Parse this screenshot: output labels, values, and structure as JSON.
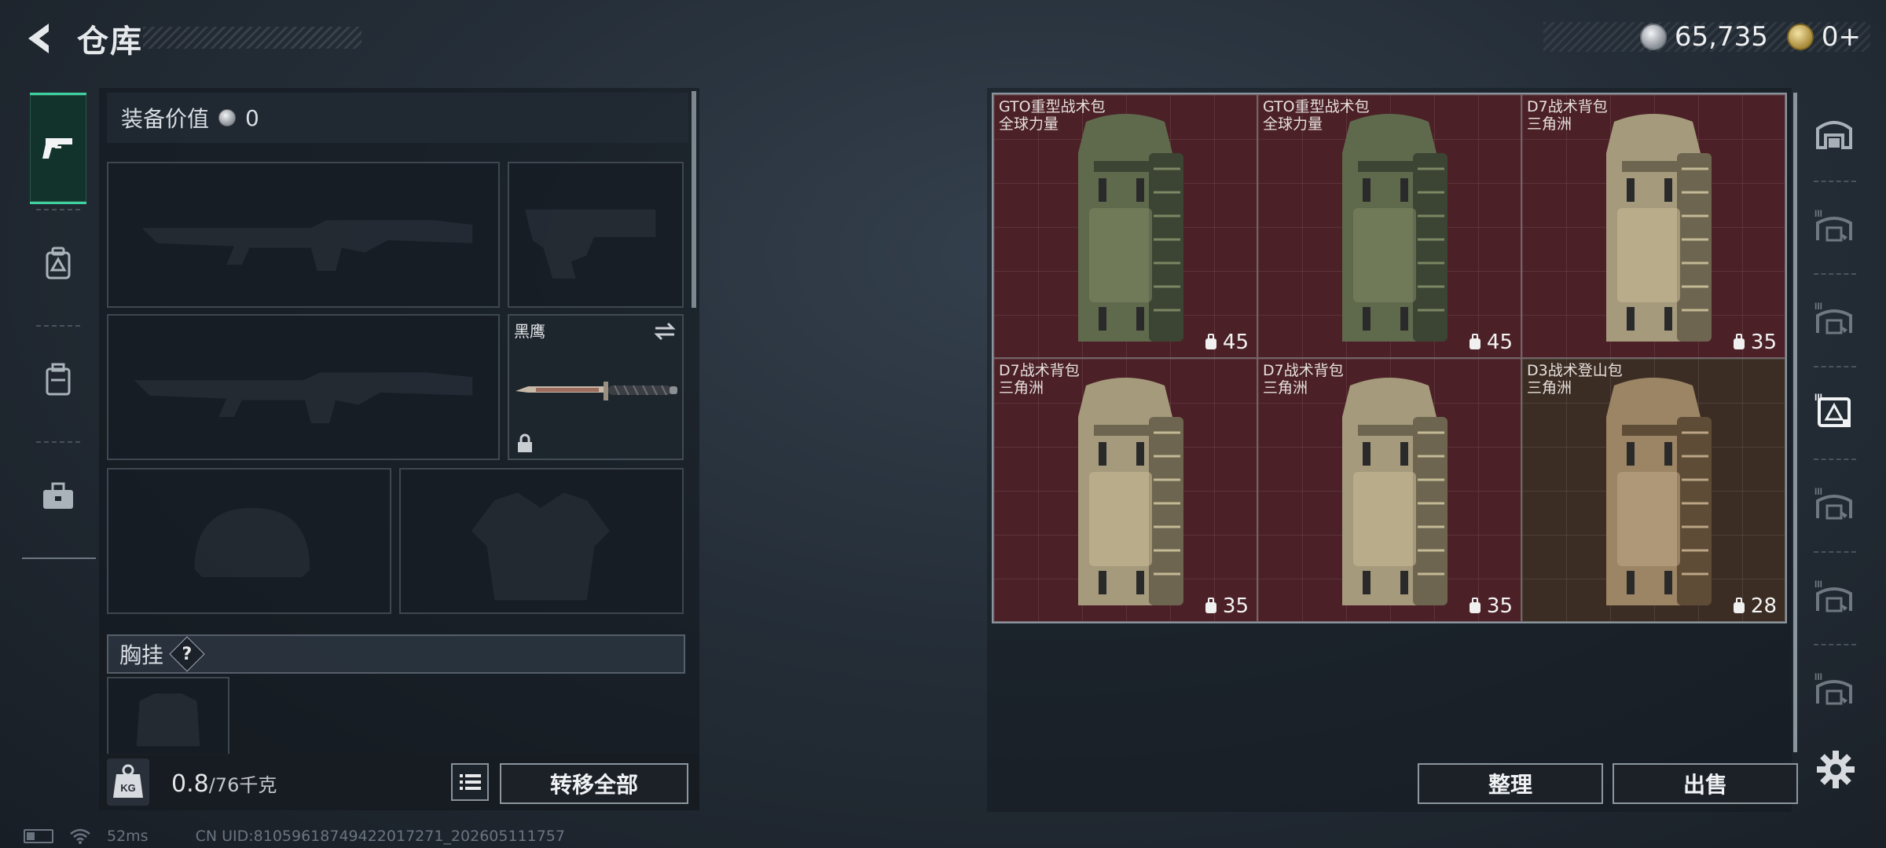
{
  "header": {
    "title": "仓库",
    "currency": [
      {
        "icon": "silver-coin-icon",
        "value": "65,735"
      },
      {
        "icon": "gold-coin-icon",
        "value": "0+"
      }
    ]
  },
  "left_tabs": [
    {
      "icon": "pistol-icon",
      "active": true
    },
    {
      "icon": "backpack-icon",
      "active": false
    },
    {
      "icon": "container-icon",
      "active": false
    },
    {
      "icon": "toolbox-icon",
      "active": false
    }
  ],
  "loadout": {
    "equip_value_label": "装备价值",
    "equip_value": "0",
    "melee_name": "黑鹰",
    "chest_rig_label": "胸挂",
    "help_label": "?",
    "weight_current": "0.8",
    "weight_max": "/76千克",
    "transfer_all_label": "转移全部"
  },
  "inventory": {
    "items": [
      {
        "name": "GTO重型战术包",
        "brand": "全球力量",
        "capacity": "45",
        "color": "olive"
      },
      {
        "name": "GTO重型战术包",
        "brand": "全球力量",
        "capacity": "45",
        "color": "olive"
      },
      {
        "name": "D7战术背包",
        "brand": "三角洲",
        "capacity": "35",
        "color": "tan"
      },
      {
        "name": "D7战术背包",
        "brand": "三角洲",
        "capacity": "35",
        "color": "tan"
      },
      {
        "name": "D7战术背包",
        "brand": "三角洲",
        "capacity": "35",
        "color": "tan"
      },
      {
        "name": "D3战术登山包",
        "brand": "三角洲",
        "capacity": "28",
        "color": "camo"
      }
    ],
    "sort_label": "整理",
    "sell_label": "出售"
  },
  "category_rail": [
    {
      "icon": "warehouse-icon",
      "active": false
    },
    {
      "icon": "warehouse-tier3-icon",
      "active": false
    },
    {
      "icon": "warehouse-tier3-icon",
      "active": false
    },
    {
      "icon": "backpack-category-icon",
      "active": true
    },
    {
      "icon": "warehouse-tier3-icon",
      "active": false
    },
    {
      "icon": "warehouse-tier3-icon",
      "active": false
    },
    {
      "icon": "warehouse-tier3-icon",
      "active": false
    }
  ],
  "status": {
    "ping": "52ms",
    "uid": "CN UID:8105961874942201​7271_202605111757"
  },
  "colors": {
    "accent": "#3fd2a0",
    "item_bg_red": "#4b2027",
    "item_bg_brown": "#3c2d24"
  }
}
